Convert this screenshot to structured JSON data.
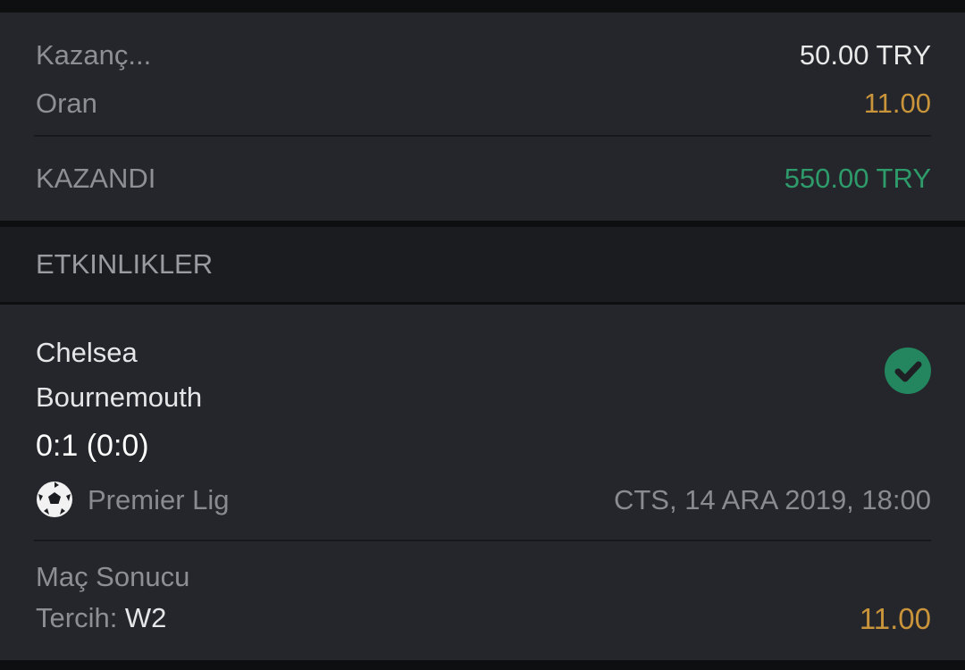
{
  "summary": {
    "stake_label": "Kazanç...",
    "stake_value": "50.00 TRY",
    "odds_label": "Oran",
    "odds_value": "11.00",
    "result_label": "KAZANDI",
    "result_value": "550.00 TRY"
  },
  "events_header": "ETKINLIKLER",
  "event": {
    "home_team": "Chelsea",
    "away_team": "Bournemouth",
    "score": "0:1 (0:0)",
    "league": "Premier Lig",
    "datetime": "CTS, 14 ARA 2019, 18:00",
    "market": "Maç Sonucu",
    "selection_label": "Tercih:",
    "selection_value": "W2",
    "selection_odds": "11.00",
    "status_icon": "check-circle-icon",
    "sport_icon": "soccer-ball-icon"
  },
  "colors": {
    "background": "#0e0f11",
    "panel": "#25262b",
    "gold": "#c9943a",
    "green": "#2e9b6b",
    "status_green": "#23865f"
  }
}
